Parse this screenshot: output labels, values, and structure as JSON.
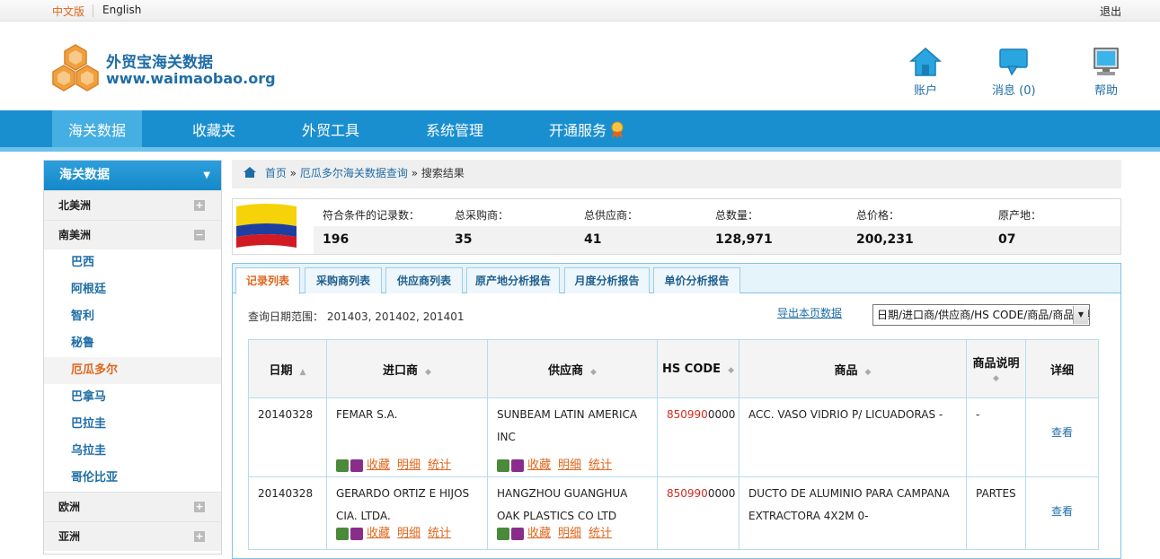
{
  "topbar": {
    "lang_cn": "中文版",
    "lang_en": "English",
    "logout": "退出"
  },
  "header": {
    "title": "外贸宝海关数据",
    "url": "www.waimaobao.org",
    "icons": [
      {
        "name": "home-icon",
        "label": "账户"
      },
      {
        "name": "message-icon",
        "label": "消息 (0)"
      },
      {
        "name": "help-icon",
        "label": "帮助"
      }
    ]
  },
  "nav": {
    "items": [
      "海关数据",
      "收藏夹",
      "外贸工具",
      "系统管理",
      "开通服务"
    ],
    "active": "海关数据"
  },
  "sidebar": {
    "title": "海关数据",
    "regions": {
      "north_america": "北美洲",
      "south_america": "南美洲",
      "europe": "欧洲",
      "asia": "亚洲"
    },
    "countries": [
      "巴西",
      "阿根廷",
      "智利",
      "秘鲁",
      "厄瓜多尔",
      "巴拿马",
      "巴拉圭",
      "乌拉圭",
      "哥伦比亚"
    ],
    "selected_country": "厄瓜多尔"
  },
  "breadcrumb": {
    "home": "首页",
    "query": "厄瓜多尔海关数据查询",
    "current": "搜索结果",
    "sep": "»"
  },
  "summary": {
    "labels": [
      "符合条件的记录数：",
      "总采购商：",
      "总供应商：",
      "总数量：",
      "总价格：",
      "原产地："
    ],
    "values": [
      "196",
      "35",
      "41",
      "128,971",
      "200,231",
      "07"
    ]
  },
  "tabs": [
    "记录列表",
    "采购商列表",
    "供应商列表",
    "原产地分析报告",
    "月度分析报告",
    "单价分析报告"
  ],
  "active_tab": "记录列表",
  "query": {
    "daterange": "查询日期范围： 201403, 201402, 201401",
    "export": "导出本页数据",
    "sort_value": "日期/进口商/供应商/HS CODE/商品/商品说明"
  },
  "table": {
    "headers": [
      "日期",
      "进口商",
      "供应商",
      "HS CODE",
      "商品",
      "商品说明",
      "详细"
    ],
    "actions": {
      "favorite": "收藏",
      "detail": "明细",
      "stats": "统计",
      "view": "查看"
    },
    "rows": [
      {
        "date": "20140328",
        "importer": "FEMAR S.A.",
        "supplier": "SUNBEAM LATIN AMERICA INC",
        "hs_red": "850990",
        "hs_rest": "0000",
        "product": "ACC. VASO VIDRIO P/ LICUADORAS -",
        "desc": "-"
      },
      {
        "date": "20140328",
        "importer": "GERARDO ORTIZ E HIJOS CIA. LTDA.",
        "supplier": "HANGZHOU GUANGHUA OAK PLASTICS CO LTD",
        "hs_red": "850990",
        "hs_rest": "0000",
        "product": "DUCTO DE ALUMINIO PARA CAMPANA EXTRACTORA 4X2M 0-",
        "desc": "PARTES"
      }
    ]
  },
  "colors": {
    "brand_blue": "#1a8fd0",
    "link": "#1f6da6",
    "accent_orange": "#e0661d",
    "hs_red": "#d3291d"
  }
}
